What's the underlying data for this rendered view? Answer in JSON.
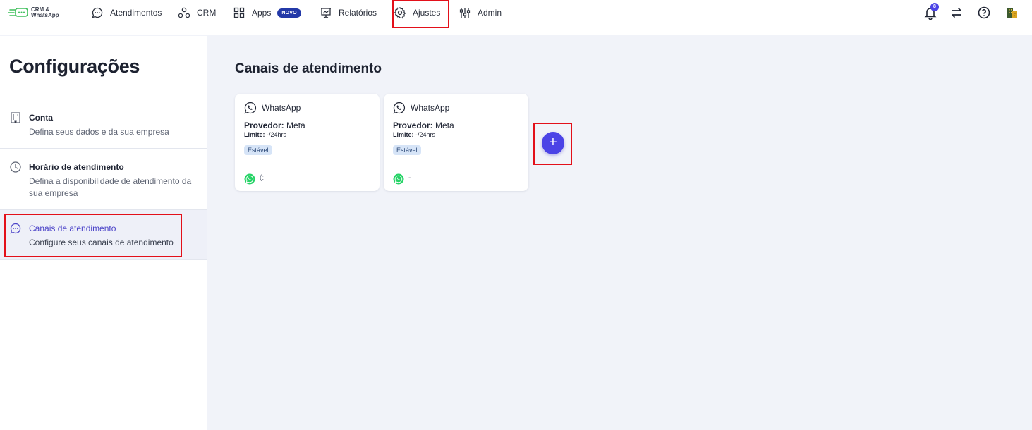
{
  "logo": {
    "line1": "CRM &",
    "line2": "WhatsApp"
  },
  "nav": [
    {
      "label": "Atendimentos",
      "icon": "chat-icon"
    },
    {
      "label": "CRM",
      "icon": "nodes-icon"
    },
    {
      "label": "Apps",
      "icon": "grid-icon",
      "badge": "NOVO"
    },
    {
      "label": "Relatórios",
      "icon": "presentation-icon"
    },
    {
      "label": "Ajustes",
      "icon": "gear-icon"
    },
    {
      "label": "Admin",
      "icon": "sliders-icon"
    }
  ],
  "topbar_right": {
    "notification_count": "8",
    "icons": [
      "bell-icon",
      "swap-icon",
      "help-icon",
      "company-icon"
    ]
  },
  "sidebar": {
    "title": "Configurações",
    "items": [
      {
        "label": "Conta",
        "desc": "Defina seus dados e da sua empresa",
        "icon": "building-icon"
      },
      {
        "label": "Horário de atendimento",
        "desc": "Defina a disponibilidade de atendimento da sua empresa",
        "icon": "clock-icon"
      },
      {
        "label": "Canais de atendimento",
        "desc": "Configure seus canais de atendimento",
        "icon": "chat-icon",
        "active": true
      }
    ]
  },
  "main": {
    "title": "Canais de atendimento",
    "cards": [
      {
        "channel": "WhatsApp",
        "provider_label": "Provedor:",
        "provider": "Meta",
        "limit_label": "Limite:",
        "limit": "-/24hrs",
        "status": "Estável",
        "number": "(:"
      },
      {
        "channel": "WhatsApp",
        "provider_label": "Provedor:",
        "provider": "Meta",
        "limit_label": "Limite:",
        "limit": "-/24hrs",
        "status": "Estável",
        "number": "-"
      }
    ],
    "add_button": "+"
  },
  "colors": {
    "accent": "#4b43e6",
    "highlight": "#e3101a",
    "badge": "#2339a8",
    "whatsapp": "#25d366"
  }
}
